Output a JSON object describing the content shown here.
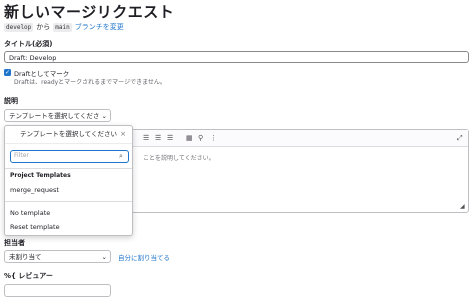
{
  "page": {
    "title": "新しいマージリクエスト",
    "source_branch": "develop",
    "from_text": "から",
    "target_branch": "main",
    "change_branches_link": "ブランチを変更"
  },
  "title_field": {
    "label": "タイトル(必須)",
    "value": "Draft: Develop"
  },
  "draft": {
    "checkbox_label": "Draftとしてマーク",
    "hint": "Draftは、readyとマークされるまでマージできません。"
  },
  "description": {
    "label": "説明",
    "template_button_label": "テンプレートを選択してください",
    "editor_placeholder": "ことを説明してください。"
  },
  "template_dropdown": {
    "header": "テンプレートを選択してください",
    "search_placeholder": "Filter",
    "section_title": "Project Templates",
    "items": [
      "merge_request"
    ],
    "footer_items": [
      "No template",
      "Reset template"
    ]
  },
  "assignee": {
    "label": "担当者",
    "select_value": "未割り当て",
    "assign_to_me_link": "自分に割り当てる"
  },
  "reviewer": {
    "label": "%{ レビュアー"
  },
  "icons": {
    "checkbox": "check-icon",
    "close": "close-icon",
    "search": "search-icon",
    "chevron": "chevron-down-icon",
    "expand": "expand-icon"
  }
}
